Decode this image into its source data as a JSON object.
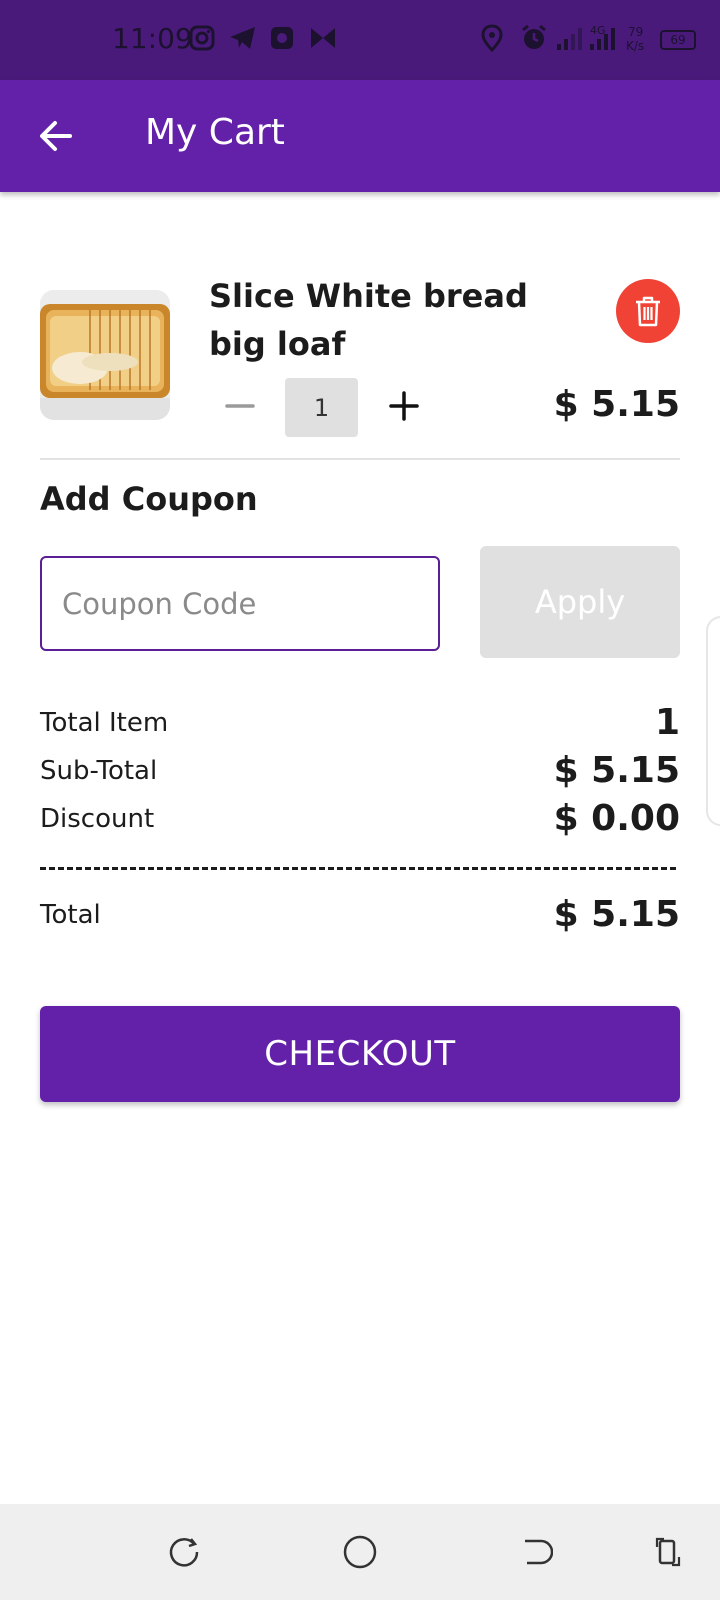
{
  "status_bar": {
    "time": "11:09",
    "network_label": "4G",
    "speed_value": "79",
    "speed_unit": "K/s",
    "battery": "69"
  },
  "app_bar": {
    "title": "My Cart"
  },
  "cart": {
    "items": [
      {
        "name": "Slice White bread big loaf",
        "quantity": "1",
        "price": "$ 5.15"
      }
    ]
  },
  "coupon": {
    "heading": "Add Coupon",
    "placeholder": "Coupon Code",
    "value": "",
    "apply_label": "Apply"
  },
  "summary": {
    "total_item_label": "Total Item",
    "total_item_value": "1",
    "subtotal_label": "Sub-Total",
    "subtotal_value": "$ 5.15",
    "discount_label": "Discount",
    "discount_value": "$ 0.00",
    "total_label": "Total",
    "total_value": "$ 5.15"
  },
  "checkout": {
    "label": "CHECKOUT"
  },
  "colors": {
    "status_bar": "#4a1a7a",
    "primary": "#6321a9",
    "delete": "#f04336",
    "disabled": "#e0e0e0"
  },
  "icons": {
    "back": "arrow-left-icon",
    "delete": "trash-icon",
    "minus": "minus-icon",
    "plus": "plus-icon"
  }
}
